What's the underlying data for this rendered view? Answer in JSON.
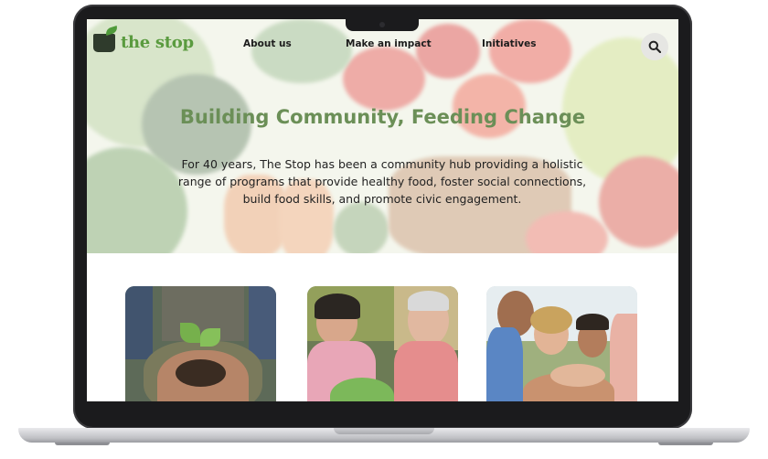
{
  "brand": {
    "name": "the stop",
    "logo_icon": "pot-with-leaf-icon",
    "color": "#5a9b3f"
  },
  "nav": {
    "items": [
      {
        "label": "About us"
      },
      {
        "label": "Make an impact"
      },
      {
        "label": "Initiatives"
      }
    ],
    "search_icon": "search-icon"
  },
  "hero": {
    "title": "Building Community, Feeding Change",
    "description": "For 40 years, The Stop has been a community hub providing a holistic range of programs that provide healthy food, foster social connections, build food skills, and promote civic engagement.",
    "title_color": "#6b8f57",
    "background": "photo of fresh vegetables and fruit in a basket"
  },
  "cards": [
    {
      "image": "hands holding seedling in soil"
    },
    {
      "image": "two people eating a meal together"
    },
    {
      "image": "group of people stacking hands"
    }
  ]
}
